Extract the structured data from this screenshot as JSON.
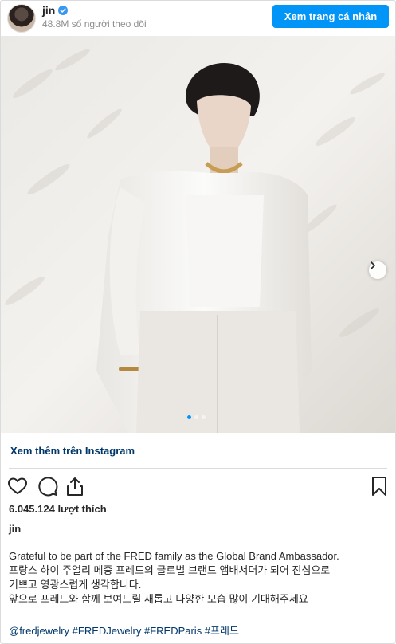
{
  "header": {
    "username": "jin",
    "followers": "48.8M số người theo dõi",
    "view_profile_label": "Xem trang cá nhân"
  },
  "photo": {
    "carousel_total": 3,
    "carousel_active": 1
  },
  "view_more_label": "Xem thêm trên Instagram",
  "likes": "6.045.124 lượt thích",
  "caption": {
    "username": "jin",
    "lines": [
      "Grateful to be part of the FRED family as the Global Brand Ambassador.",
      "프랑스 하이 주얼리 메종 프레드의 글로벌 브랜드 앰배서더가 되어 진심으로",
      "기쁘고 영광스럽게 생각합니다.",
      "앞으로 프레드와 함께 보여드릴 새롭고 다양한 모습 많이 기대해주세요"
    ],
    "hashtags": "@fredjewelry #FREDJewelry #FREDParis #프레드"
  },
  "colors": {
    "accent": "#0095f6",
    "link": "#00376b",
    "muted": "#8e8e8e"
  },
  "icons": [
    "verified-badge-icon",
    "chevron-right-icon",
    "heart-icon",
    "comment-icon",
    "share-icon",
    "bookmark-icon"
  ]
}
